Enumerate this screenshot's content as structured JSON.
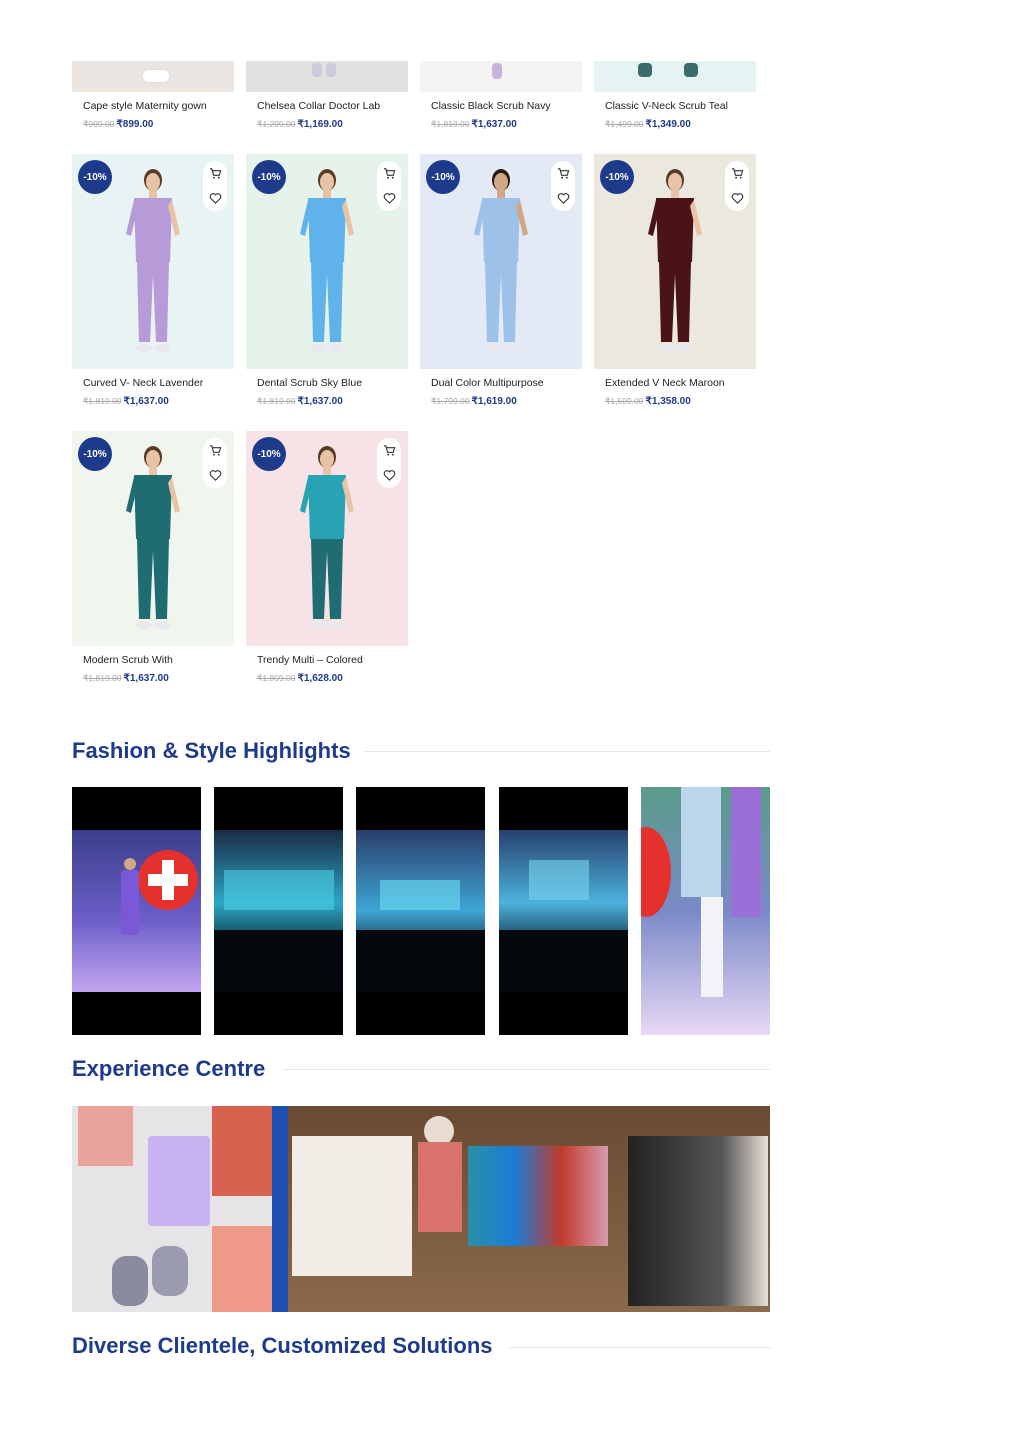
{
  "products_top": [
    {
      "name": "Cape style Maternity gown",
      "old_price": "₹999.00",
      "price": "₹899.00",
      "bg": "#ece6e2"
    },
    {
      "name": "Chelsea Collar Doctor Lab",
      "old_price": "₹1,299.00",
      "price": "₹1,169.00",
      "bg": "#dfe2de"
    },
    {
      "name": "Classic Black Scrub Navy",
      "old_price": "₹1,819.00",
      "price": "₹1,637.00",
      "bg": "#f3f3f3"
    },
    {
      "name": "Classic V-Neck Scrub Teal",
      "old_price": "₹1,499.00",
      "price": "₹1,349.00",
      "bg": "#e5f3f3"
    }
  ],
  "products_mid": [
    {
      "name": "Curved V- Neck Lavender",
      "old_price": "₹1,819.00",
      "price": "₹1,637.00",
      "badge": "-10%",
      "bg": "#e8f3f3",
      "top": "#b79ad8",
      "bottom": "#b79ad8",
      "skin": "#e8c3a6",
      "hair": "#5a3a24"
    },
    {
      "name": "Dental Scrub Sky Blue",
      "old_price": "₹1,819.00",
      "price": "₹1,637.00",
      "badge": "-10%",
      "bg": "#e5f3ea",
      "top": "#5fb3ea",
      "bottom": "#5fb3ea",
      "skin": "#e8c3a6",
      "hair": "#5a3a24"
    },
    {
      "name": "Dual Color Multipurpose",
      "old_price": "₹1,799.00",
      "price": "₹1,619.00",
      "badge": "-10%",
      "bg": "#e3e9f5",
      "top": "#9ec1ea",
      "bottom": "#9ec1ea",
      "skin": "#d2a788",
      "hair": "#2a1b12"
    },
    {
      "name": "Extended V Neck Maroon",
      "old_price": "₹1,509.00",
      "price": "₹1,358.00",
      "badge": "-10%",
      "bg": "#ebe8e0",
      "top": "#4a1417",
      "bottom": "#4a1417",
      "skin": "#e8c3a6",
      "hair": "#5a3a24"
    }
  ],
  "products_bottom": [
    {
      "name": "Modern Scrub With",
      "old_price": "₹1,819.00",
      "price": "₹1,637.00",
      "badge": "-10%",
      "bg": "#f0f5ee",
      "top": "#1f6c73",
      "bottom": "#1f6c73",
      "skin": "#e8c3a6",
      "hair": "#5a3a24"
    },
    {
      "name": "Trendy Multi – Colored",
      "old_price": "₹1,809.00",
      "price": "₹1,628.00",
      "badge": "-10%",
      "bg": "#f7e3e6",
      "top": "#27a3b4",
      "bottom": "#1f6c73",
      "skin": "#e8c3a6",
      "hair": "#5a3a24"
    }
  ],
  "sections": {
    "fashion": "Fashion & Style Highlights",
    "experience": "Experience Centre",
    "clientele": "Diverse Clientele, Customized Solutions"
  },
  "icons": {
    "cart": "cart-icon",
    "wishlist": "heart-icon"
  },
  "colors": {
    "brand": "#1e3a8a",
    "badge": "#1e3a8a",
    "price": "#1e3a8a"
  }
}
